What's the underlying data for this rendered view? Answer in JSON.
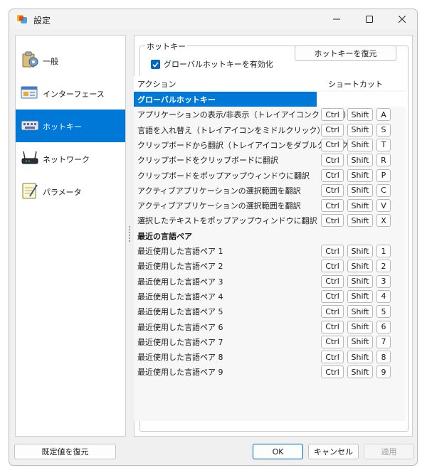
{
  "window": {
    "title": "設定"
  },
  "sidebar": {
    "items": [
      {
        "label": "一般",
        "icon": "settings-tools-icon"
      },
      {
        "label": "インターフェース",
        "icon": "interface-window-icon"
      },
      {
        "label": "ホットキー",
        "icon": "keyboard-icon",
        "active": true
      },
      {
        "label": "ネットワーク",
        "icon": "router-icon"
      },
      {
        "label": "パラメータ",
        "icon": "notepad-icon"
      }
    ]
  },
  "hotkeys": {
    "group_label": "ホットキー",
    "enable_global_label": "グローバルホットキーを有効化",
    "enable_global_checked": true,
    "restore_button": "ホットキーを復元",
    "columns": {
      "action": "アクション",
      "shortcut": "ショートカット"
    },
    "rows": [
      {
        "action": "グローバルホットキー",
        "group": true,
        "selected": true
      },
      {
        "action": "アプリケーションの表示/非表示（トレイアイコンクリック）",
        "ctrl": "Ctrl",
        "shift": "Shift",
        "key": "A"
      },
      {
        "action": "言語を入れ替え（トレイアイコンをミドルクリック）",
        "ctrl": "Ctrl",
        "shift": "Shift",
        "key": "S"
      },
      {
        "action": "クリップボードから翻訳（トレイアイコンをダブルクリック）",
        "ctrl": "Ctrl",
        "shift": "Shift",
        "key": "T"
      },
      {
        "action": "クリップボードをクリップボードに翻訳",
        "ctrl": "Ctrl",
        "shift": "Shift",
        "key": "R"
      },
      {
        "action": "クリップボードをポップアップウィンドウに翻訳",
        "ctrl": "Ctrl",
        "shift": "Shift",
        "key": "P"
      },
      {
        "action": "アクティブアプリケーションの選択範囲を翻訳",
        "ctrl": "Ctrl",
        "shift": "Shift",
        "key": "C"
      },
      {
        "action": "アクティブアプリケーションの選択範囲を翻訳",
        "ctrl": "Ctrl",
        "shift": "Shift",
        "key": "V"
      },
      {
        "action": "選択したテキストをポップアップウィンドウに翻訳",
        "ctrl": "Ctrl",
        "shift": "Shift",
        "key": "X"
      },
      {
        "action": "最近の言語ペア",
        "group": true
      },
      {
        "action": "最近使用した言語ペア 1",
        "ctrl": "Ctrl",
        "shift": "Shift",
        "key": "1"
      },
      {
        "action": "最近使用した言語ペア 2",
        "ctrl": "Ctrl",
        "shift": "Shift",
        "key": "2"
      },
      {
        "action": "最近使用した言語ペア 3",
        "ctrl": "Ctrl",
        "shift": "Shift",
        "key": "3"
      },
      {
        "action": "最近使用した言語ペア 4",
        "ctrl": "Ctrl",
        "shift": "Shift",
        "key": "4"
      },
      {
        "action": "最近使用した言語ペア 5",
        "ctrl": "Ctrl",
        "shift": "Shift",
        "key": "5"
      },
      {
        "action": "最近使用した言語ペア 6",
        "ctrl": "Ctrl",
        "shift": "Shift",
        "key": "6"
      },
      {
        "action": "最近使用した言語ペア 7",
        "ctrl": "Ctrl",
        "shift": "Shift",
        "key": "7"
      },
      {
        "action": "最近使用した言語ペア 8",
        "ctrl": "Ctrl",
        "shift": "Shift",
        "key": "8"
      },
      {
        "action": "最近使用した言語ペア 9",
        "ctrl": "Ctrl",
        "shift": "Shift",
        "key": "9"
      }
    ]
  },
  "footer": {
    "restore_defaults": "既定値を復元",
    "ok": "OK",
    "cancel": "キャンセル",
    "apply": "適用"
  },
  "colors": {
    "accent": "#0078d7"
  }
}
